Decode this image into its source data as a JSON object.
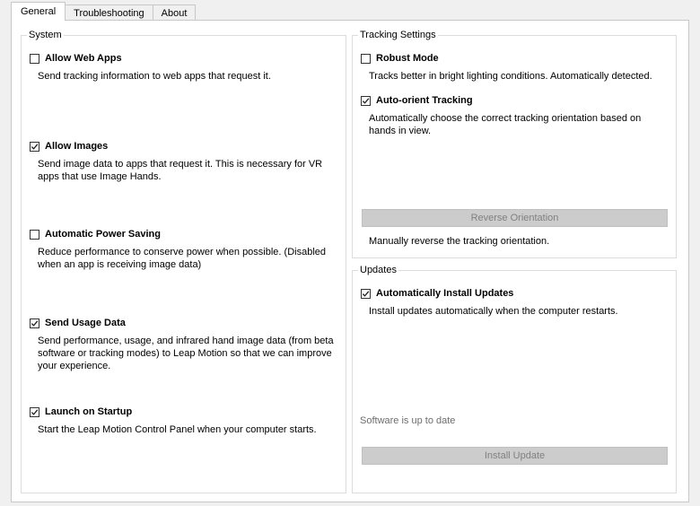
{
  "tabs": [
    {
      "label": "General"
    },
    {
      "label": "Troubleshooting"
    },
    {
      "label": "About"
    }
  ],
  "system": {
    "title": "System",
    "options": [
      {
        "label": "Allow Web Apps",
        "checked": false,
        "description": "Send tracking information to web apps that request it."
      },
      {
        "label": "Allow Images",
        "checked": true,
        "description": "Send image data to apps that request it. This is necessary for VR apps that use Image Hands."
      },
      {
        "label": "Automatic Power Saving",
        "checked": false,
        "description": "Reduce performance to conserve power when possible. (Disabled when an app is receiving image data)"
      },
      {
        "label": "Send Usage Data",
        "checked": true,
        "description": "Send performance, usage, and infrared hand image data (from beta software or tracking modes) to Leap Motion so that we can improve your experience."
      },
      {
        "label": "Launch on Startup",
        "checked": true,
        "description": "Start the Leap Motion Control Panel when your computer starts."
      }
    ]
  },
  "tracking": {
    "title": "Tracking Settings",
    "options": [
      {
        "label": "Robust Mode",
        "checked": false,
        "description": "Tracks better in bright lighting conditions. Automatically detected."
      },
      {
        "label": "Auto-orient Tracking",
        "checked": true,
        "description": "Automatically choose the correct tracking orientation based on hands in view."
      }
    ],
    "reverse_button": "Reverse Orientation",
    "reverse_description": "Manually reverse the tracking orientation."
  },
  "updates": {
    "title": "Updates",
    "options": [
      {
        "label": "Automatically Install Updates",
        "checked": true,
        "description": "Install updates automatically when the computer restarts."
      }
    ],
    "status": "Software is up to date",
    "install_button": "Install Update"
  },
  "colors": {
    "window_bg": "#f0f0f0",
    "panel_bg": "#ffffff",
    "disabled_button_bg": "#cccccc",
    "disabled_text": "#808080",
    "status_text": "#6d6d6d"
  }
}
